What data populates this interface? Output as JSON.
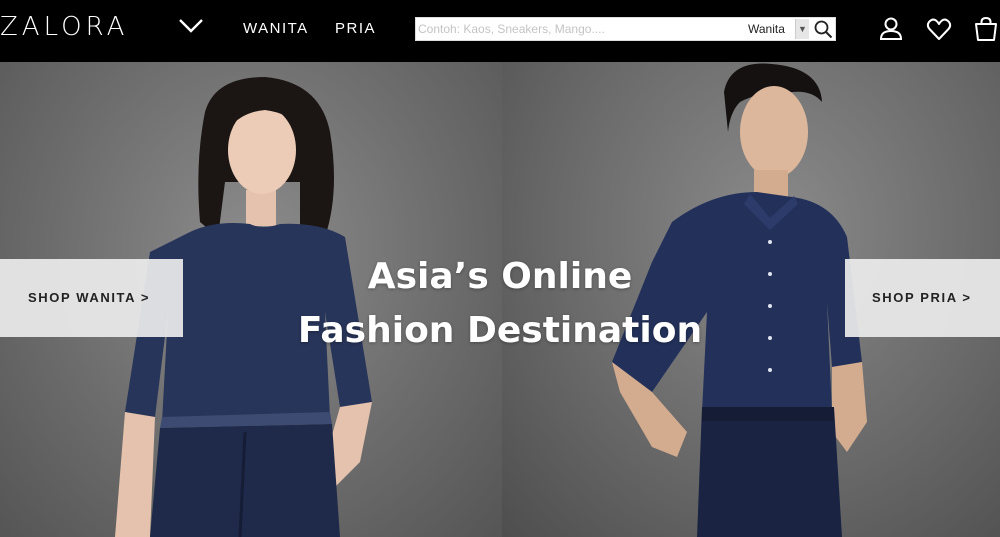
{
  "header": {
    "logo": "ZALORA",
    "nav": {
      "wanita": "WANITA",
      "pria": "PRIA"
    },
    "search": {
      "placeholder": "Contoh: Kaos, Sneakers, Mango....",
      "value": "",
      "category": "Wanita"
    },
    "icons": [
      "chevron-down-icon",
      "search-icon",
      "user-icon",
      "heart-icon",
      "shopping-bag-icon"
    ]
  },
  "hero": {
    "title_line1": "Asia’s Online",
    "title_line2": "Fashion Destination",
    "shop_wanita": "SHOP WANITA >",
    "shop_pria": "SHOP PRIA >"
  },
  "colors": {
    "header_bg": "#000000",
    "header_text": "#ffffff",
    "button_bg": "#ebebeb",
    "denim": "#1f2a4a"
  }
}
